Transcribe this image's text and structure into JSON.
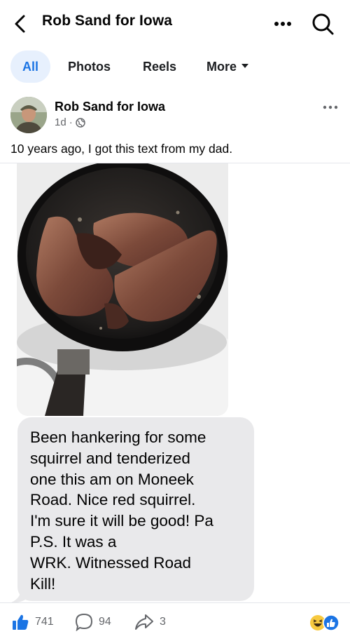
{
  "header": {
    "title": "Rob Sand for Iowa",
    "back_icon": "chevron-left-icon",
    "more_icon": "more-horizontal-icon",
    "search_icon": "search-icon"
  },
  "tabs": [
    {
      "label": "All",
      "active": true
    },
    {
      "label": "Photos",
      "active": false
    },
    {
      "label": "Reels",
      "active": false
    },
    {
      "label": "More",
      "active": false,
      "icon": "caret-down-icon"
    }
  ],
  "post": {
    "author": "Rob Sand for Iowa",
    "time": "1d",
    "separator": "·",
    "privacy_icon": "globe-icon",
    "caption": "10 years ago, I got this text from my dad.",
    "message": "Been hankering for some\nsquirrel and tenderized\none this am on Moneek\nRoad. Nice red squirrel.\nI'm sure it will be good! Pa\nP.S. It was a\nWRK.  Witnessed Road\nKill!"
  },
  "footer": {
    "like_count": "741",
    "comment_count": "94",
    "share_count": "3",
    "like_icon": "thumbs-up-icon",
    "comment_icon": "comment-icon",
    "share_icon": "share-icon",
    "reaction_icons": [
      "haha-icon",
      "like-reaction-icon"
    ]
  },
  "colors": {
    "accent": "#1b74e4",
    "tab_active_bg": "#e7f0fd",
    "secondary_text": "#65676b",
    "bubble_bg": "#e9e9eb"
  }
}
